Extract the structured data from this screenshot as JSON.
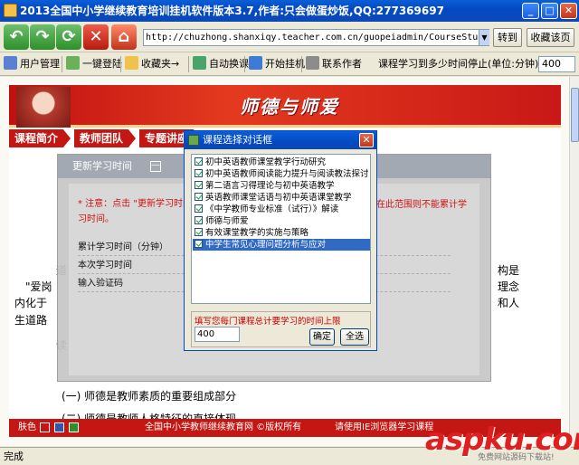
{
  "window": {
    "title": "2013全国中小学继续教育培训挂机软件版本3.7,作者:只会做蛋炒饭,QQ:277369697",
    "controls": [
      "_",
      "□",
      "✕"
    ]
  },
  "toolbar": {
    "address": "http://chuzhong.shanxiqy.teacher.com.cn/guopeiadmin/CourseStudy/Stu",
    "go_label": "转到",
    "fav_label": "收藏该页"
  },
  "toolbar2": {
    "items": [
      "用户管理",
      "一键登陆",
      "收藏夹→",
      "自动换课",
      "开始挂机",
      "联系作者"
    ],
    "time_prompt": "课程学习到多少时间停止(单位:分钟)》》",
    "time_value": "400"
  },
  "page": {
    "banner_title": "师德与师爱",
    "tabs": [
      "课程简介",
      "教师团队",
      "专题讲座"
    ],
    "body_lines": [
      "(一) 师德是教师素质的重要组成部分",
      "(二) 师德是教师人格特征的直接体现"
    ],
    "partial_text": {
      "l1": "道",
      "l2": "\"爱岗",
      "l3": "内化于",
      "l4": "生道路",
      "l5": "读",
      "r1": "构是",
      "r2": "理念",
      "r3": "和人"
    },
    "footer": {
      "skin_label": "肤色",
      "copyright": "全国中小学教师继续教育网 ©版权所有",
      "browser_hint": "请使用IE浏览器学习课程"
    }
  },
  "overlay": {
    "header": "更新学习时间",
    "min_symbol": "—",
    "note": "* 注意：点击 \"更新学习时间",
    "note_right": "在此范围则不能累计学",
    "note_line2": "习时间。",
    "fields": [
      "累计学习时间（分钟）",
      "本次学习时间",
      "输入验证码"
    ]
  },
  "dialog": {
    "title": "课程选择对话框",
    "courses": [
      "初中英语教师课堂教学行动研究",
      "初中英语教师阅读能力提升与阅读教法探讨",
      "第二语言习得理论与初中英语教学",
      "英语教师课堂话语与初中英语课堂教学",
      "《中学教师专业标准（试行）》解读",
      "师德与师爱",
      "有效课堂教学的实施与策略",
      "中学生常见心理问题分析与应对"
    ],
    "selected_index": 7,
    "limit_label": "填写您每门课程总计要学习的时间上限",
    "limit_value": "400",
    "ok_label": "确定",
    "all_label": "全选"
  },
  "status_bar": {
    "text": "完成"
  },
  "watermark": {
    "main": "aspku.com",
    "sub": "免费网站源码下载站!"
  },
  "colors": {
    "brand_red": "#c41612",
    "xp_blue": "#0a5fd6",
    "selection": "#316ac5"
  }
}
